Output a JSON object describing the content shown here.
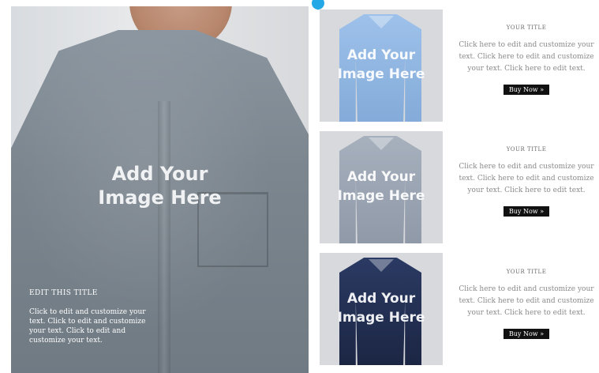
{
  "hero": {
    "overlay_line1": "Add Your",
    "overlay_line2": "Image Here",
    "caption_title": "EDIT THIS TITLE",
    "caption_body": "Click to edit and customize your text. Click to edit and customize your text. Click to edit and customize your text."
  },
  "products": [
    {
      "shirt_color": "#8fb7e3",
      "overlay_line1": "Add Your",
      "overlay_line2": "Image Here",
      "title": "YOUR TITLE",
      "body": "Click here to edit and customize your text. Click here to edit and customize your text. Click here to edit text.",
      "button": "Buy Now »"
    },
    {
      "shirt_color": "#9aa4b3",
      "overlay_line1": "Add Your",
      "overlay_line2": "Image Here",
      "title": "YOUR TITLE",
      "body": "Click here to edit and customize your text. Click here to edit and customize your text. Click here to edit text.",
      "button": "Buy Now »"
    },
    {
      "shirt_color": "#233052",
      "overlay_line1": "Add Your",
      "overlay_line2": "Image Here",
      "title": "YOUR TITLE",
      "body": "Click here to edit and customize your text. Click here to edit and customize your text. Click here to edit text.",
      "button": "Buy Now »"
    }
  ],
  "colors": {
    "marker": "#24a8e6",
    "button_bg": "#111111"
  },
  "icons": {
    "marker": "location-pin-icon"
  }
}
